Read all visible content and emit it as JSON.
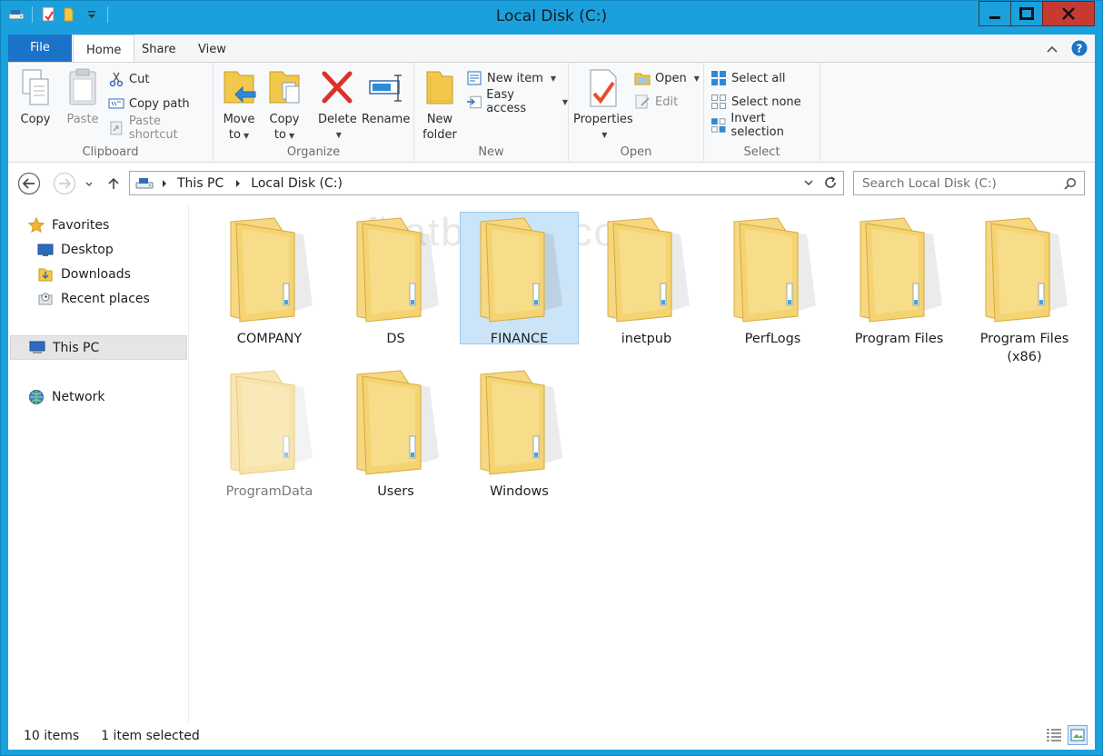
{
  "window": {
    "title": "Local Disk (C:)"
  },
  "colors": {
    "titlebar": "#1aa0dd",
    "file_tab": "#1a73c9",
    "close_button": "#c73a32",
    "selection": "#cce4f7",
    "folder_yellow": "#f4d371"
  },
  "ribbon": {
    "tabs": {
      "file": "File",
      "home": "Home",
      "share": "Share",
      "view": "View"
    },
    "clipboard": {
      "copy": "Copy",
      "paste": "Paste",
      "cut": "Cut",
      "copy_path": "Copy path",
      "paste_shortcut": "Paste shortcut",
      "label": "Clipboard"
    },
    "organize": {
      "move_to": "Move",
      "move_to_2": "to",
      "copy_to": "Copy",
      "copy_to_2": "to",
      "delete": "Delete",
      "rename": "Rename",
      "label": "Organize"
    },
    "new": {
      "new_folder": "New",
      "new_folder_2": "folder",
      "new_item": "New item",
      "easy_access": "Easy access",
      "label": "New"
    },
    "open": {
      "properties": "Properties",
      "open": "Open",
      "edit": "Edit",
      "label": "Open"
    },
    "select": {
      "select_all": "Select all",
      "select_none": "Select none",
      "invert_selection": "Invert selection",
      "label": "Select"
    }
  },
  "address": {
    "crumbs": [
      "This PC",
      "Local Disk (C:)"
    ],
    "search_placeholder": "Search Local Disk (C:)"
  },
  "nav": {
    "favorites": "Favorites",
    "desktop": "Desktop",
    "downloads": "Downloads",
    "recent": "Recent places",
    "this_pc": "This PC",
    "network": "Network"
  },
  "watermark": "firatboyan.com",
  "folders": [
    {
      "name": "COMPANY"
    },
    {
      "name": "DS"
    },
    {
      "name": "FINANCE"
    },
    {
      "name": "inetpub"
    },
    {
      "name": "PerfLogs"
    },
    {
      "name": "Program Files"
    },
    {
      "name": "Program Files (x86)"
    },
    {
      "name": "ProgramData"
    },
    {
      "name": "Users"
    },
    {
      "name": "Windows"
    }
  ],
  "status": {
    "items": "10 items",
    "selected": "1 item selected"
  }
}
